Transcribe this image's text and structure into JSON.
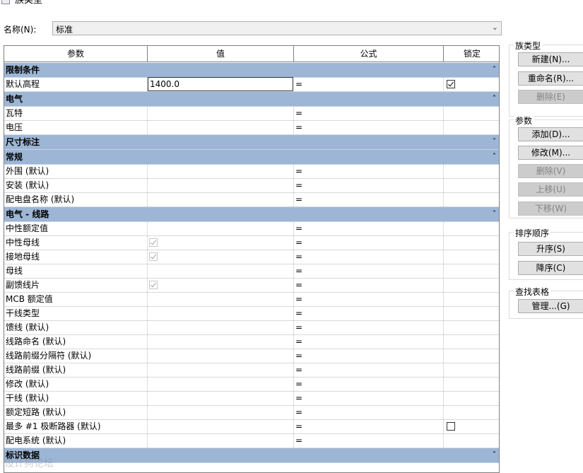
{
  "window": {
    "title": "族类型"
  },
  "name_row": {
    "label": "名称(N):",
    "value": "标准"
  },
  "columns": [
    "参数",
    "值",
    "公式",
    "锁定"
  ],
  "groups": [
    {
      "title": "限制条件",
      "toggle": "˄",
      "rows": [
        {
          "param": "默认高程",
          "value": "1400.0",
          "formula": "=",
          "editing": true,
          "locked": true
        }
      ]
    },
    {
      "title": "电气",
      "toggle": "˄",
      "rows": [
        {
          "param": "瓦特",
          "value": "",
          "formula": "="
        },
        {
          "param": "电压",
          "value": "",
          "formula": "="
        }
      ]
    },
    {
      "title": "尺寸标注",
      "toggle": "˅",
      "rows": []
    },
    {
      "title": "常规",
      "toggle": "˄",
      "rows": [
        {
          "param": "外围 (默认)",
          "value": "",
          "formula": "="
        },
        {
          "param": "安装 (默认)",
          "value": "",
          "formula": "="
        },
        {
          "param": "配电盘名称 (默认)",
          "value": "",
          "formula": "="
        }
      ]
    },
    {
      "title": "电气 - 线路",
      "toggle": "˄",
      "rows": [
        {
          "param": "中性额定值",
          "value": "",
          "formula": "="
        },
        {
          "param": "中性母线",
          "value": "",
          "value_check": true,
          "formula": "="
        },
        {
          "param": "接地母线",
          "value": "",
          "value_check": true,
          "formula": "="
        },
        {
          "param": "母线",
          "value": "",
          "formula": "="
        },
        {
          "param": "副馈线片",
          "value": "",
          "value_check": true,
          "formula": "="
        },
        {
          "param": "MCB 额定值",
          "value": "",
          "formula": "="
        },
        {
          "param": "干线类型",
          "value": "",
          "formula": "="
        },
        {
          "param": "馈线 (默认)",
          "value": "",
          "formula": "="
        },
        {
          "param": "线路命名 (默认)",
          "value": "",
          "formula": "="
        },
        {
          "param": "线路前缀分隔符 (默认)",
          "value": "",
          "formula": "="
        },
        {
          "param": "线路前缀 (默认)",
          "value": "",
          "formula": "="
        },
        {
          "param": "修改 (默认)",
          "value": "",
          "formula": "="
        },
        {
          "param": "干线 (默认)",
          "value": "",
          "formula": "="
        },
        {
          "param": "额定短路 (默认)",
          "value": "",
          "formula": "="
        },
        {
          "param": "最多 #1 极断路器 (默认)",
          "value": "",
          "formula": "=",
          "locked": false
        },
        {
          "param": "配电系统 (默认)",
          "value": "",
          "formula": "="
        }
      ]
    },
    {
      "title": "标识数据",
      "toggle": "˅",
      "rows": []
    }
  ],
  "side": {
    "family_types": {
      "title": "族类型",
      "buttons": [
        {
          "label": "新建(N)...",
          "enabled": true
        },
        {
          "label": "重命名(R)...",
          "enabled": true
        },
        {
          "label": "删除(E)",
          "enabled": false
        }
      ]
    },
    "params": {
      "title": "参数",
      "buttons": [
        {
          "label": "添加(D)...",
          "enabled": true
        },
        {
          "label": "修改(M)...",
          "enabled": true
        },
        {
          "label": "删除(V)",
          "enabled": false
        },
        {
          "label": "上移(U)",
          "enabled": false
        },
        {
          "label": "下移(W)",
          "enabled": false
        }
      ]
    },
    "sort": {
      "title": "排序顺序",
      "buttons": [
        {
          "label": "升序(S)",
          "enabled": true
        },
        {
          "label": "降序(C)",
          "enabled": true
        }
      ]
    },
    "lookup": {
      "title": "查找表格",
      "buttons": [
        {
          "label": "管理...(G)",
          "enabled": true
        }
      ]
    }
  },
  "watermark": "设计狗论坛",
  "icons": {
    "dropdown": "chevron-down-icon",
    "collapse": "collapse-chevron-icon",
    "expand": "expand-chevron-icon"
  }
}
